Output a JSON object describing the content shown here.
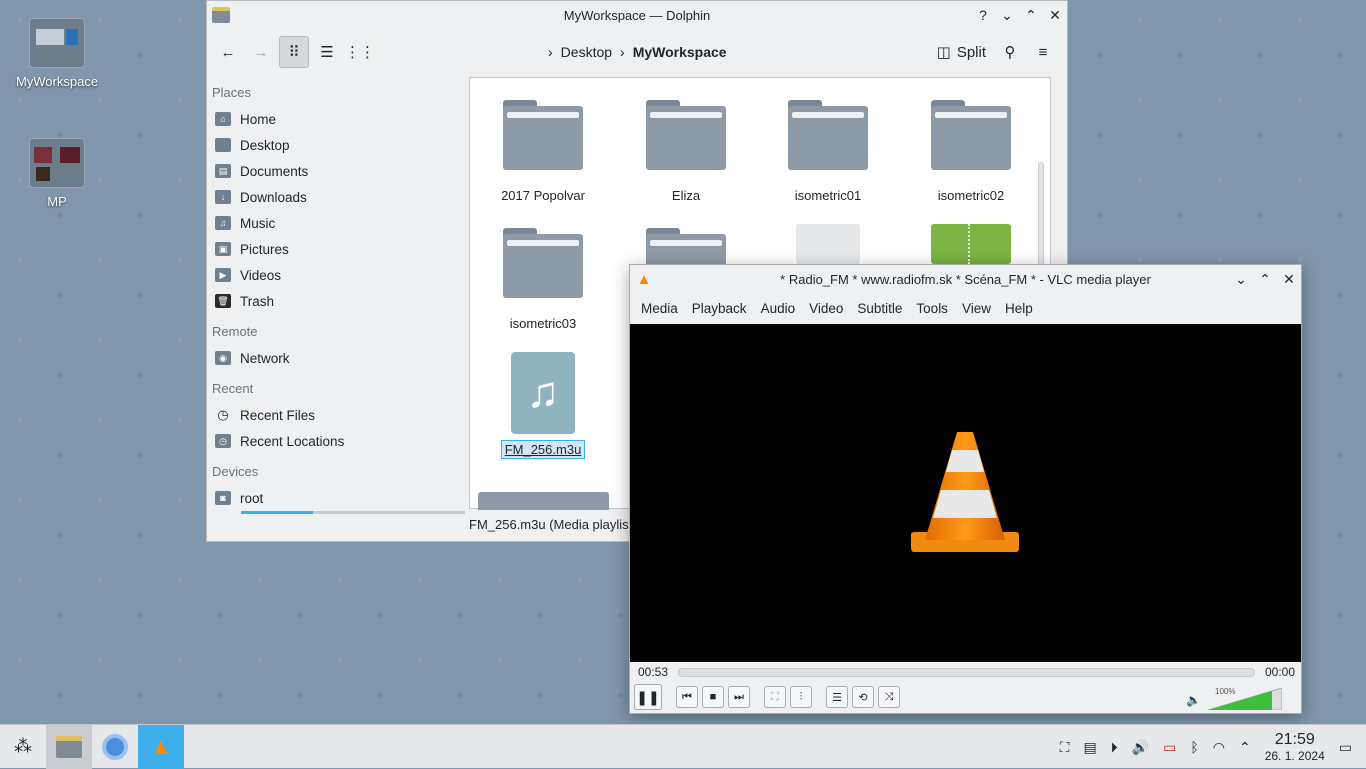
{
  "desktop": {
    "icons": [
      {
        "label": "MyWorkspace"
      },
      {
        "label": "MP"
      }
    ]
  },
  "dolphin": {
    "title": "MyWorkspace — Dolphin",
    "breadcrumb": [
      "Desktop",
      "MyWorkspace"
    ],
    "split_label": "Split",
    "places_title": "Places",
    "places": [
      "Home",
      "Desktop",
      "Documents",
      "Downloads",
      "Music",
      "Pictures",
      "Videos",
      "Trash"
    ],
    "remote_title": "Remote",
    "remote": [
      "Network"
    ],
    "recent_title": "Recent",
    "recent": [
      "Recent Files",
      "Recent Locations"
    ],
    "devices_title": "Devices",
    "devices": [
      "root"
    ],
    "files": [
      "2017 Popolvar",
      "Eliza",
      "isometric01",
      "isometric02",
      "isometric03",
      "FM_256.m3u"
    ],
    "status": "FM_256.m3u (Media playlis"
  },
  "vlc": {
    "title": "* Radio_FM * www.radiofm.sk * Scéna_FM * - VLC media player",
    "menu": [
      "Media",
      "Playback",
      "Audio",
      "Video",
      "Subtitle",
      "Tools",
      "View",
      "Help"
    ],
    "elapsed": "00:53",
    "total": "00:00",
    "volume": "100%",
    "accent": "#ff8800"
  },
  "taskbar": {
    "time": "21:59",
    "date": "26. 1. 2024"
  }
}
